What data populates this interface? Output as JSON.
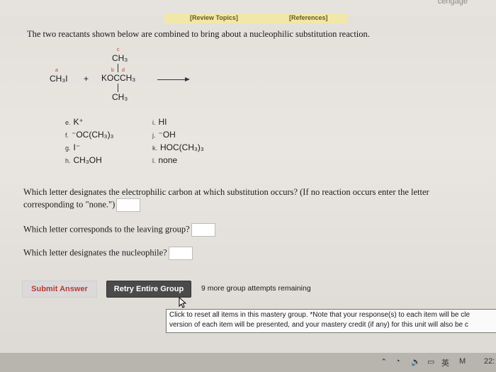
{
  "header": {
    "brand": "cengage",
    "tab_review": "[Review Topics]",
    "tab_references": "[References]"
  },
  "intro": "The two reactants shown below are combined to bring about a nucleophilic substitution reaction.",
  "reaction": {
    "reactant1": "CH₃I",
    "plus": "+",
    "reactant2_top": "CH₃",
    "reactant2_mid": "KOCCH₃",
    "reactant2_bottom": "CH₃",
    "label_a": "a",
    "label_b": "b",
    "label_c": "c",
    "label_d": "d"
  },
  "options": {
    "e": {
      "letter": "e.",
      "text": "K⁺"
    },
    "f": {
      "letter": "f.",
      "text": "⁻OC(CH₃)₃"
    },
    "g": {
      "letter": "g.",
      "text": "I⁻"
    },
    "h": {
      "letter": "h.",
      "text": "CH₃OH"
    },
    "i": {
      "letter": "i.",
      "text": "HI"
    },
    "j": {
      "letter": "j.",
      "text": "⁻OH"
    },
    "k": {
      "letter": "k.",
      "text": "HOC(CH₃)₃"
    },
    "l": {
      "letter": "l.",
      "text": "none"
    }
  },
  "questions": {
    "q1_line1": "Which letter designates the electrophilic carbon at which substitution occurs? (If no reaction occurs enter the letter",
    "q1_line2": "corresponding to \"none.\")",
    "q2": "Which letter corresponds to the leaving group?",
    "q3": "Which letter designates the nucleophile?"
  },
  "buttons": {
    "submit": "Submit Answer",
    "retry": "Retry Entire Group",
    "remaining": "9 more group attempts remaining"
  },
  "tooltip": {
    "line1": "Click to reset all items in this mastery group. *Note that your response(s) to each item will be cle",
    "line2": "version of each item will be presented, and your mastery credit (if any) for this unit will also be c"
  },
  "taskbar": {
    "lang": "英",
    "time": "22:"
  }
}
